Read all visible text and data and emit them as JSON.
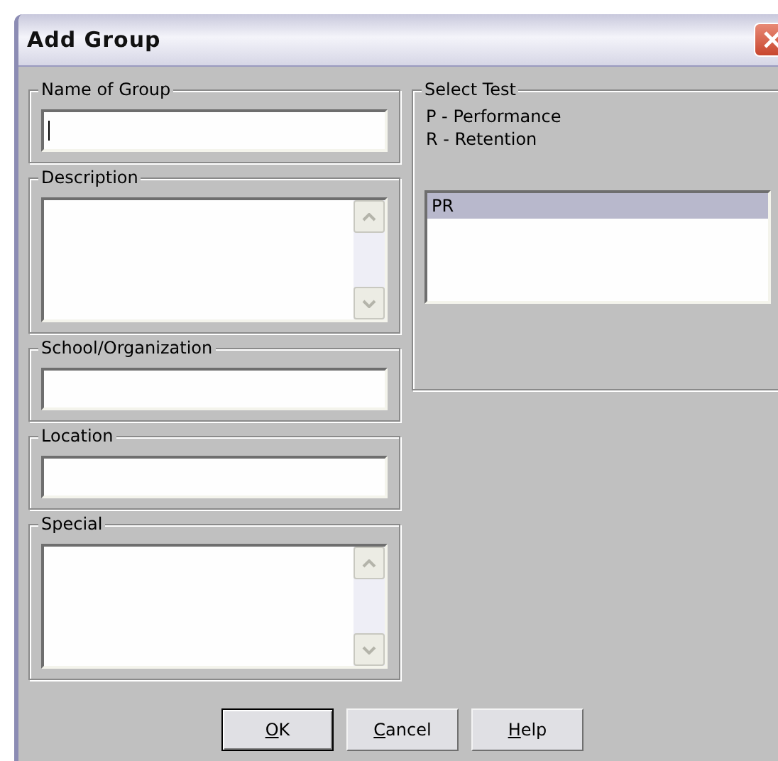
{
  "window": {
    "title": "Add Group"
  },
  "fields": [
    {
      "label": "Name of Group",
      "kind": "line",
      "focused": true
    },
    {
      "label": "Description",
      "kind": "memo",
      "focused": false
    },
    {
      "label": "School/Organization",
      "kind": "line",
      "focused": false
    },
    {
      "label": "Location",
      "kind": "line",
      "focused": false
    },
    {
      "label": "Special",
      "kind": "memo",
      "focused": false
    }
  ],
  "select_test": {
    "label": "Select Test",
    "legend": [
      "P - Performance",
      "R - Retention"
    ],
    "items": [
      {
        "label": "PR",
        "selected": true
      }
    ]
  },
  "buttons": [
    {
      "key": "O",
      "rest": "K",
      "default": true
    },
    {
      "key": "C",
      "rest": "ancel",
      "default": false
    },
    {
      "key": "H",
      "rest": "elp",
      "default": false
    }
  ]
}
